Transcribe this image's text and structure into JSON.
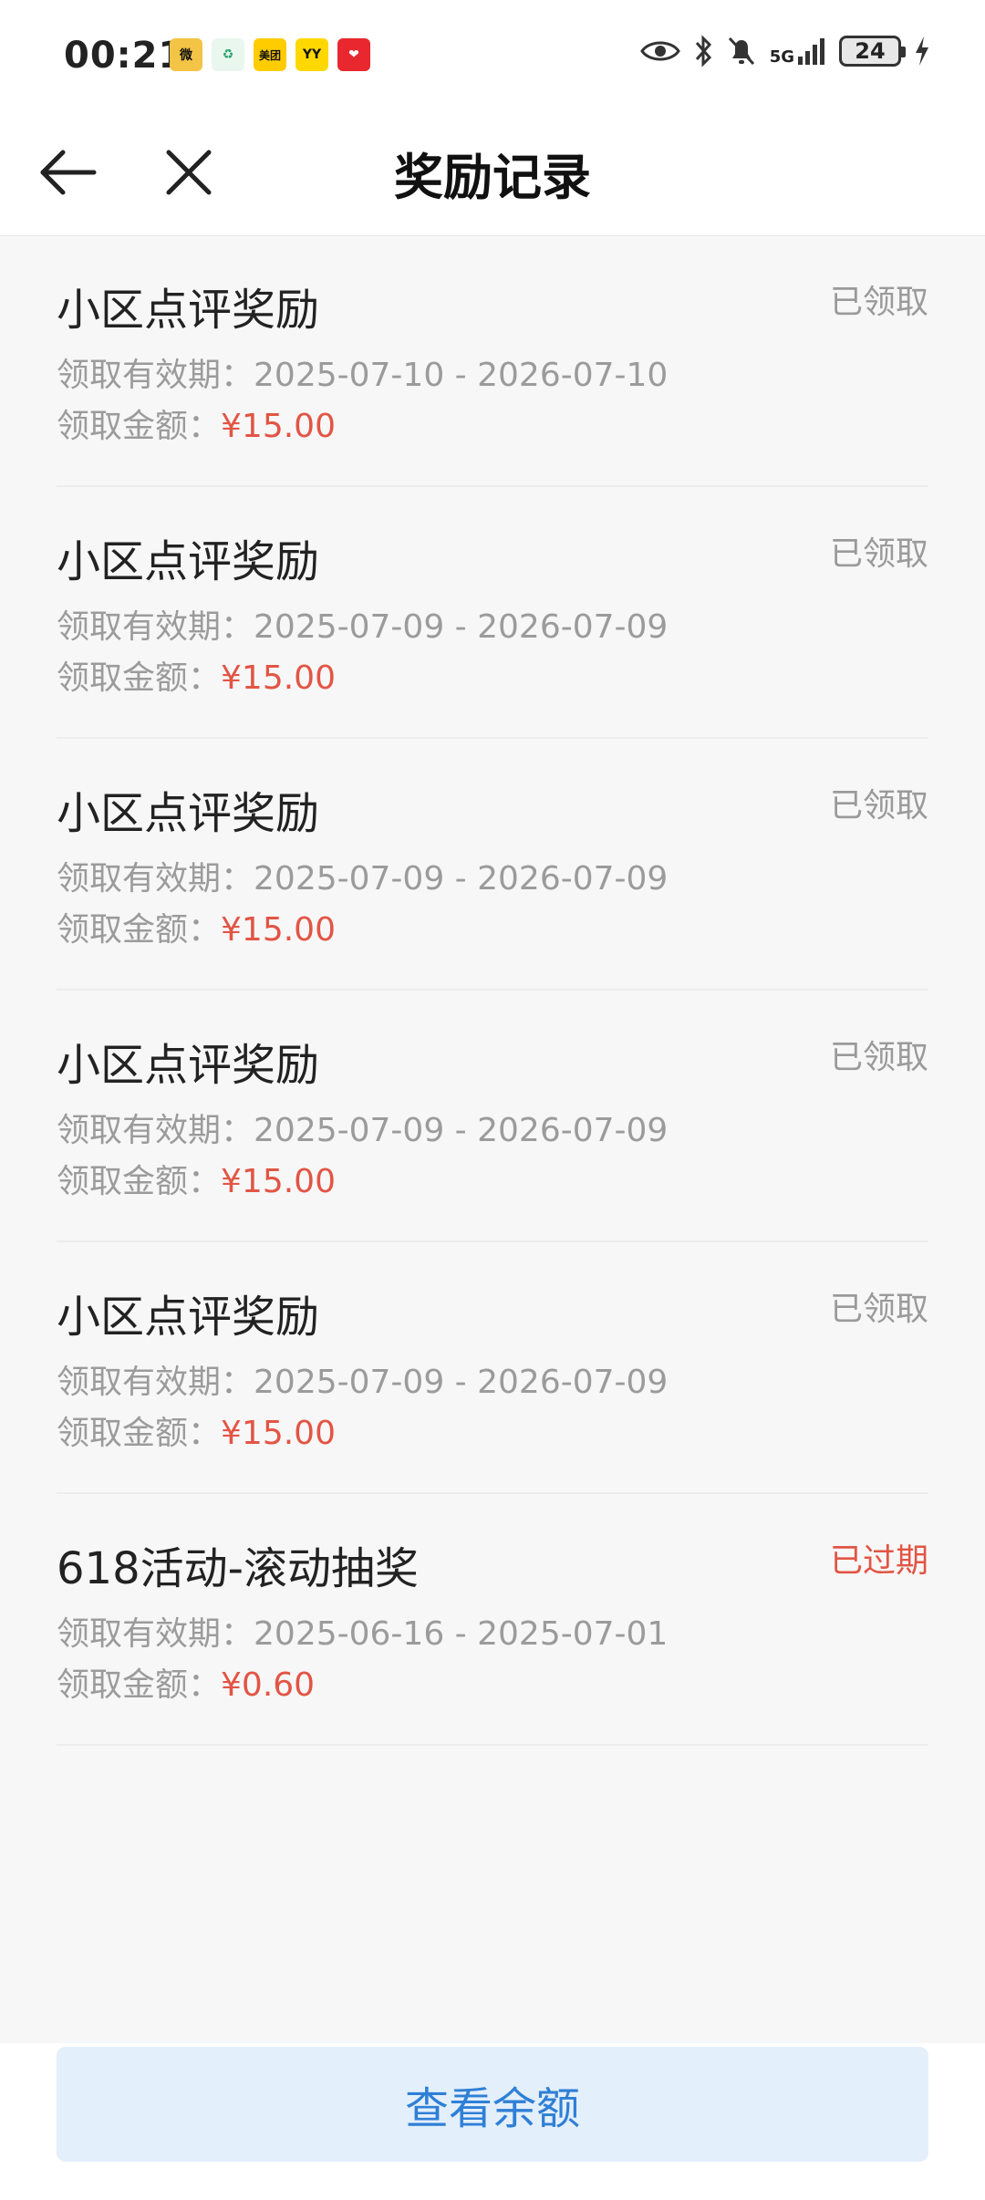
{
  "status_bar": {
    "time": "00:21",
    "apps": [
      {
        "name": "weibo-icon",
        "label": "微",
        "bg": "#f3c445"
      },
      {
        "name": "green-app-icon",
        "label": "♻",
        "bg": "#e9f7ef"
      },
      {
        "name": "meituan-icon",
        "label": "美团",
        "bg": "#ffcc00"
      },
      {
        "name": "yy-icon",
        "label": "YY",
        "bg": "#ffd800"
      },
      {
        "name": "red-app-icon",
        "label": "❤",
        "bg": "#e8282e"
      }
    ],
    "network": "5G",
    "battery": "24"
  },
  "nav": {
    "title": "奖励记录"
  },
  "records": [
    {
      "title": "小区点评奖励",
      "status": "已领取",
      "valid_label": "领取有效期：",
      "valid_range": "2025-07-10 - 2026-07-10",
      "amount_label": "领取金额：",
      "amount": "¥15.00",
      "expired": false
    },
    {
      "title": "小区点评奖励",
      "status": "已领取",
      "valid_label": "领取有效期：",
      "valid_range": "2025-07-09 - 2026-07-09",
      "amount_label": "领取金额：",
      "amount": "¥15.00",
      "expired": false
    },
    {
      "title": "小区点评奖励",
      "status": "已领取",
      "valid_label": "领取有效期：",
      "valid_range": "2025-07-09 - 2026-07-09",
      "amount_label": "领取金额：",
      "amount": "¥15.00",
      "expired": false
    },
    {
      "title": "小区点评奖励",
      "status": "已领取",
      "valid_label": "领取有效期：",
      "valid_range": "2025-07-09 - 2026-07-09",
      "amount_label": "领取金额：",
      "amount": "¥15.00",
      "expired": false
    },
    {
      "title": "小区点评奖励",
      "status": "已领取",
      "valid_label": "领取有效期：",
      "valid_range": "2025-07-09 - 2026-07-09",
      "amount_label": "领取金额：",
      "amount": "¥15.00",
      "expired": false
    },
    {
      "title": "618活动-滚动抽奖",
      "status": "已过期",
      "valid_label": "领取有效期：",
      "valid_range": "2025-06-16 - 2025-07-01",
      "amount_label": "领取金额：",
      "amount": "¥0.60",
      "expired": true
    }
  ],
  "bottom": {
    "button_label": "查看余额"
  },
  "colors": {
    "accent_red": "#e25545",
    "button_bg": "#e3effb",
    "button_text": "#2f7fd6"
  }
}
